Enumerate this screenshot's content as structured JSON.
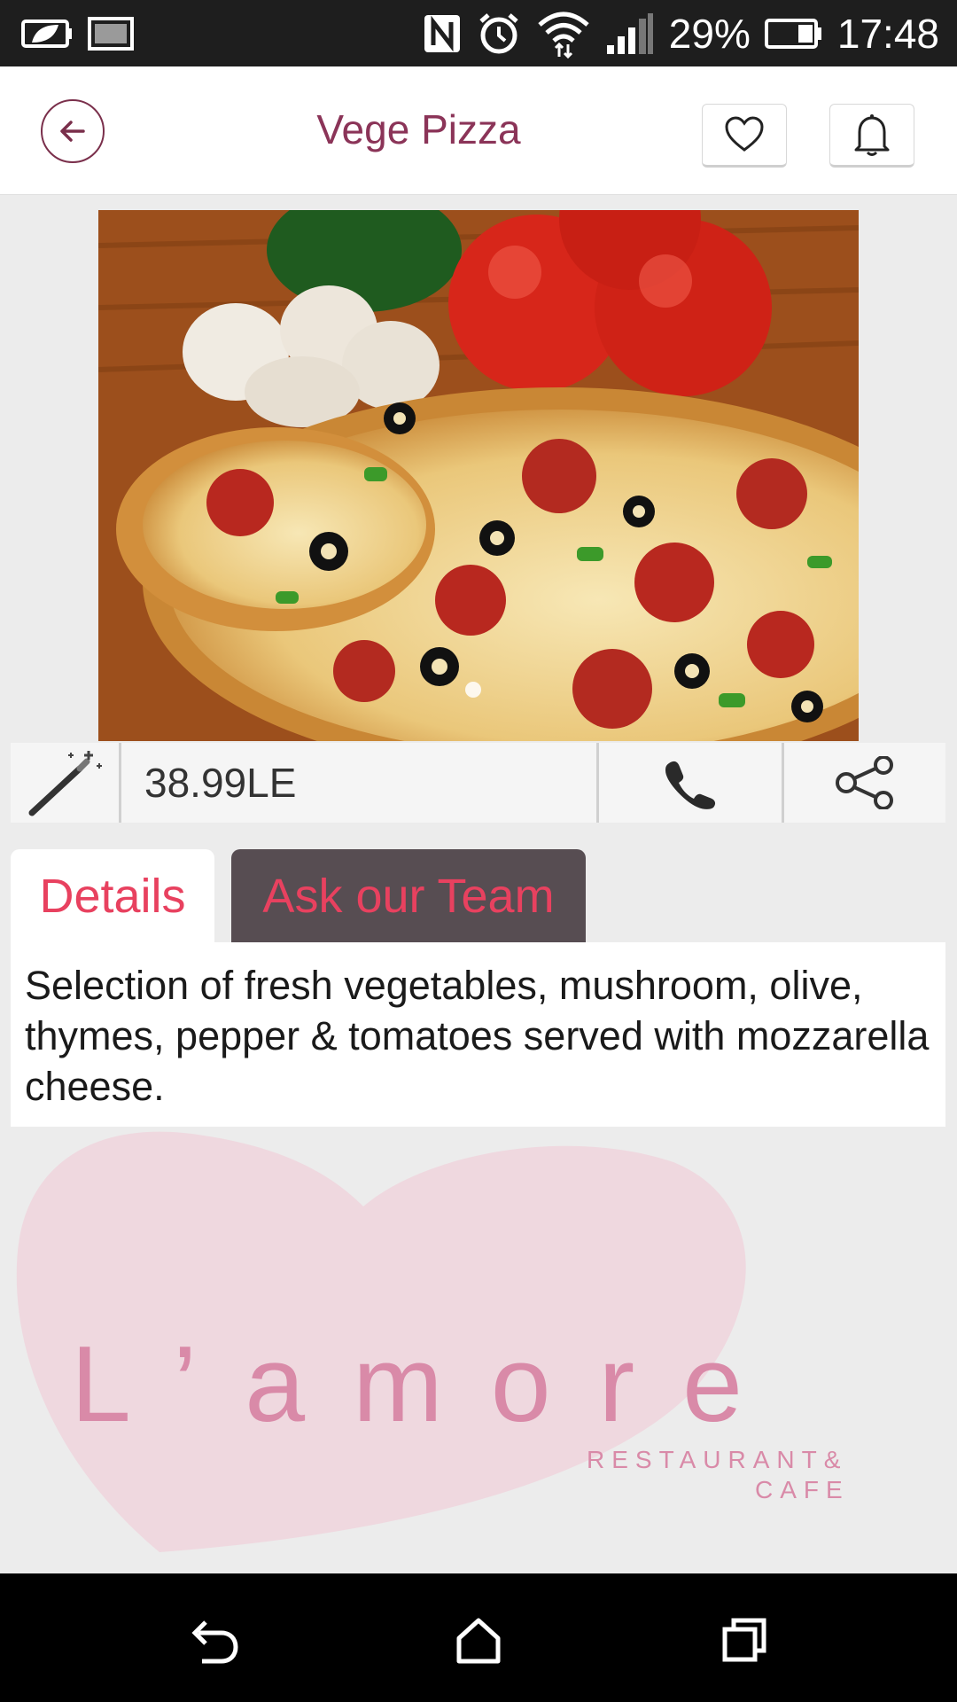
{
  "status_bar": {
    "battery_percent": "29%",
    "time": "17:48",
    "icons": [
      "battery-saver-icon",
      "image-icon",
      "nfc-icon",
      "alarm-icon",
      "wifi-icon",
      "signal-icon",
      "battery-icon"
    ]
  },
  "header": {
    "title": "Vege Pizza",
    "icons": [
      "back-arrow-icon",
      "heart-icon",
      "bell-icon"
    ]
  },
  "product": {
    "image_icon": "pizza-photo",
    "price": "38.99LE",
    "actions": [
      "magic-wand-icon",
      "phone-icon",
      "share-icon"
    ]
  },
  "tabs": [
    {
      "label": "Details",
      "active": true
    },
    {
      "label": "Ask our Team",
      "active": false
    }
  ],
  "details": {
    "description": "Selection of fresh vegetables, mushroom, olive, thymes, pepper & tomatoes served with mozzarella cheese."
  },
  "branding": {
    "logo_text": "L’amore",
    "sub_line1": "RESTAURANT&",
    "sub_line2": "CAFE",
    "logo_color": "#d98aa8"
  },
  "nav_bar": {
    "icons": [
      "nav-back-icon",
      "nav-home-icon",
      "nav-recents-icon"
    ]
  },
  "colors": {
    "accent": "#8b3458",
    "tab_label": "#e8415f",
    "inactive_tab_bg": "#574d52"
  }
}
